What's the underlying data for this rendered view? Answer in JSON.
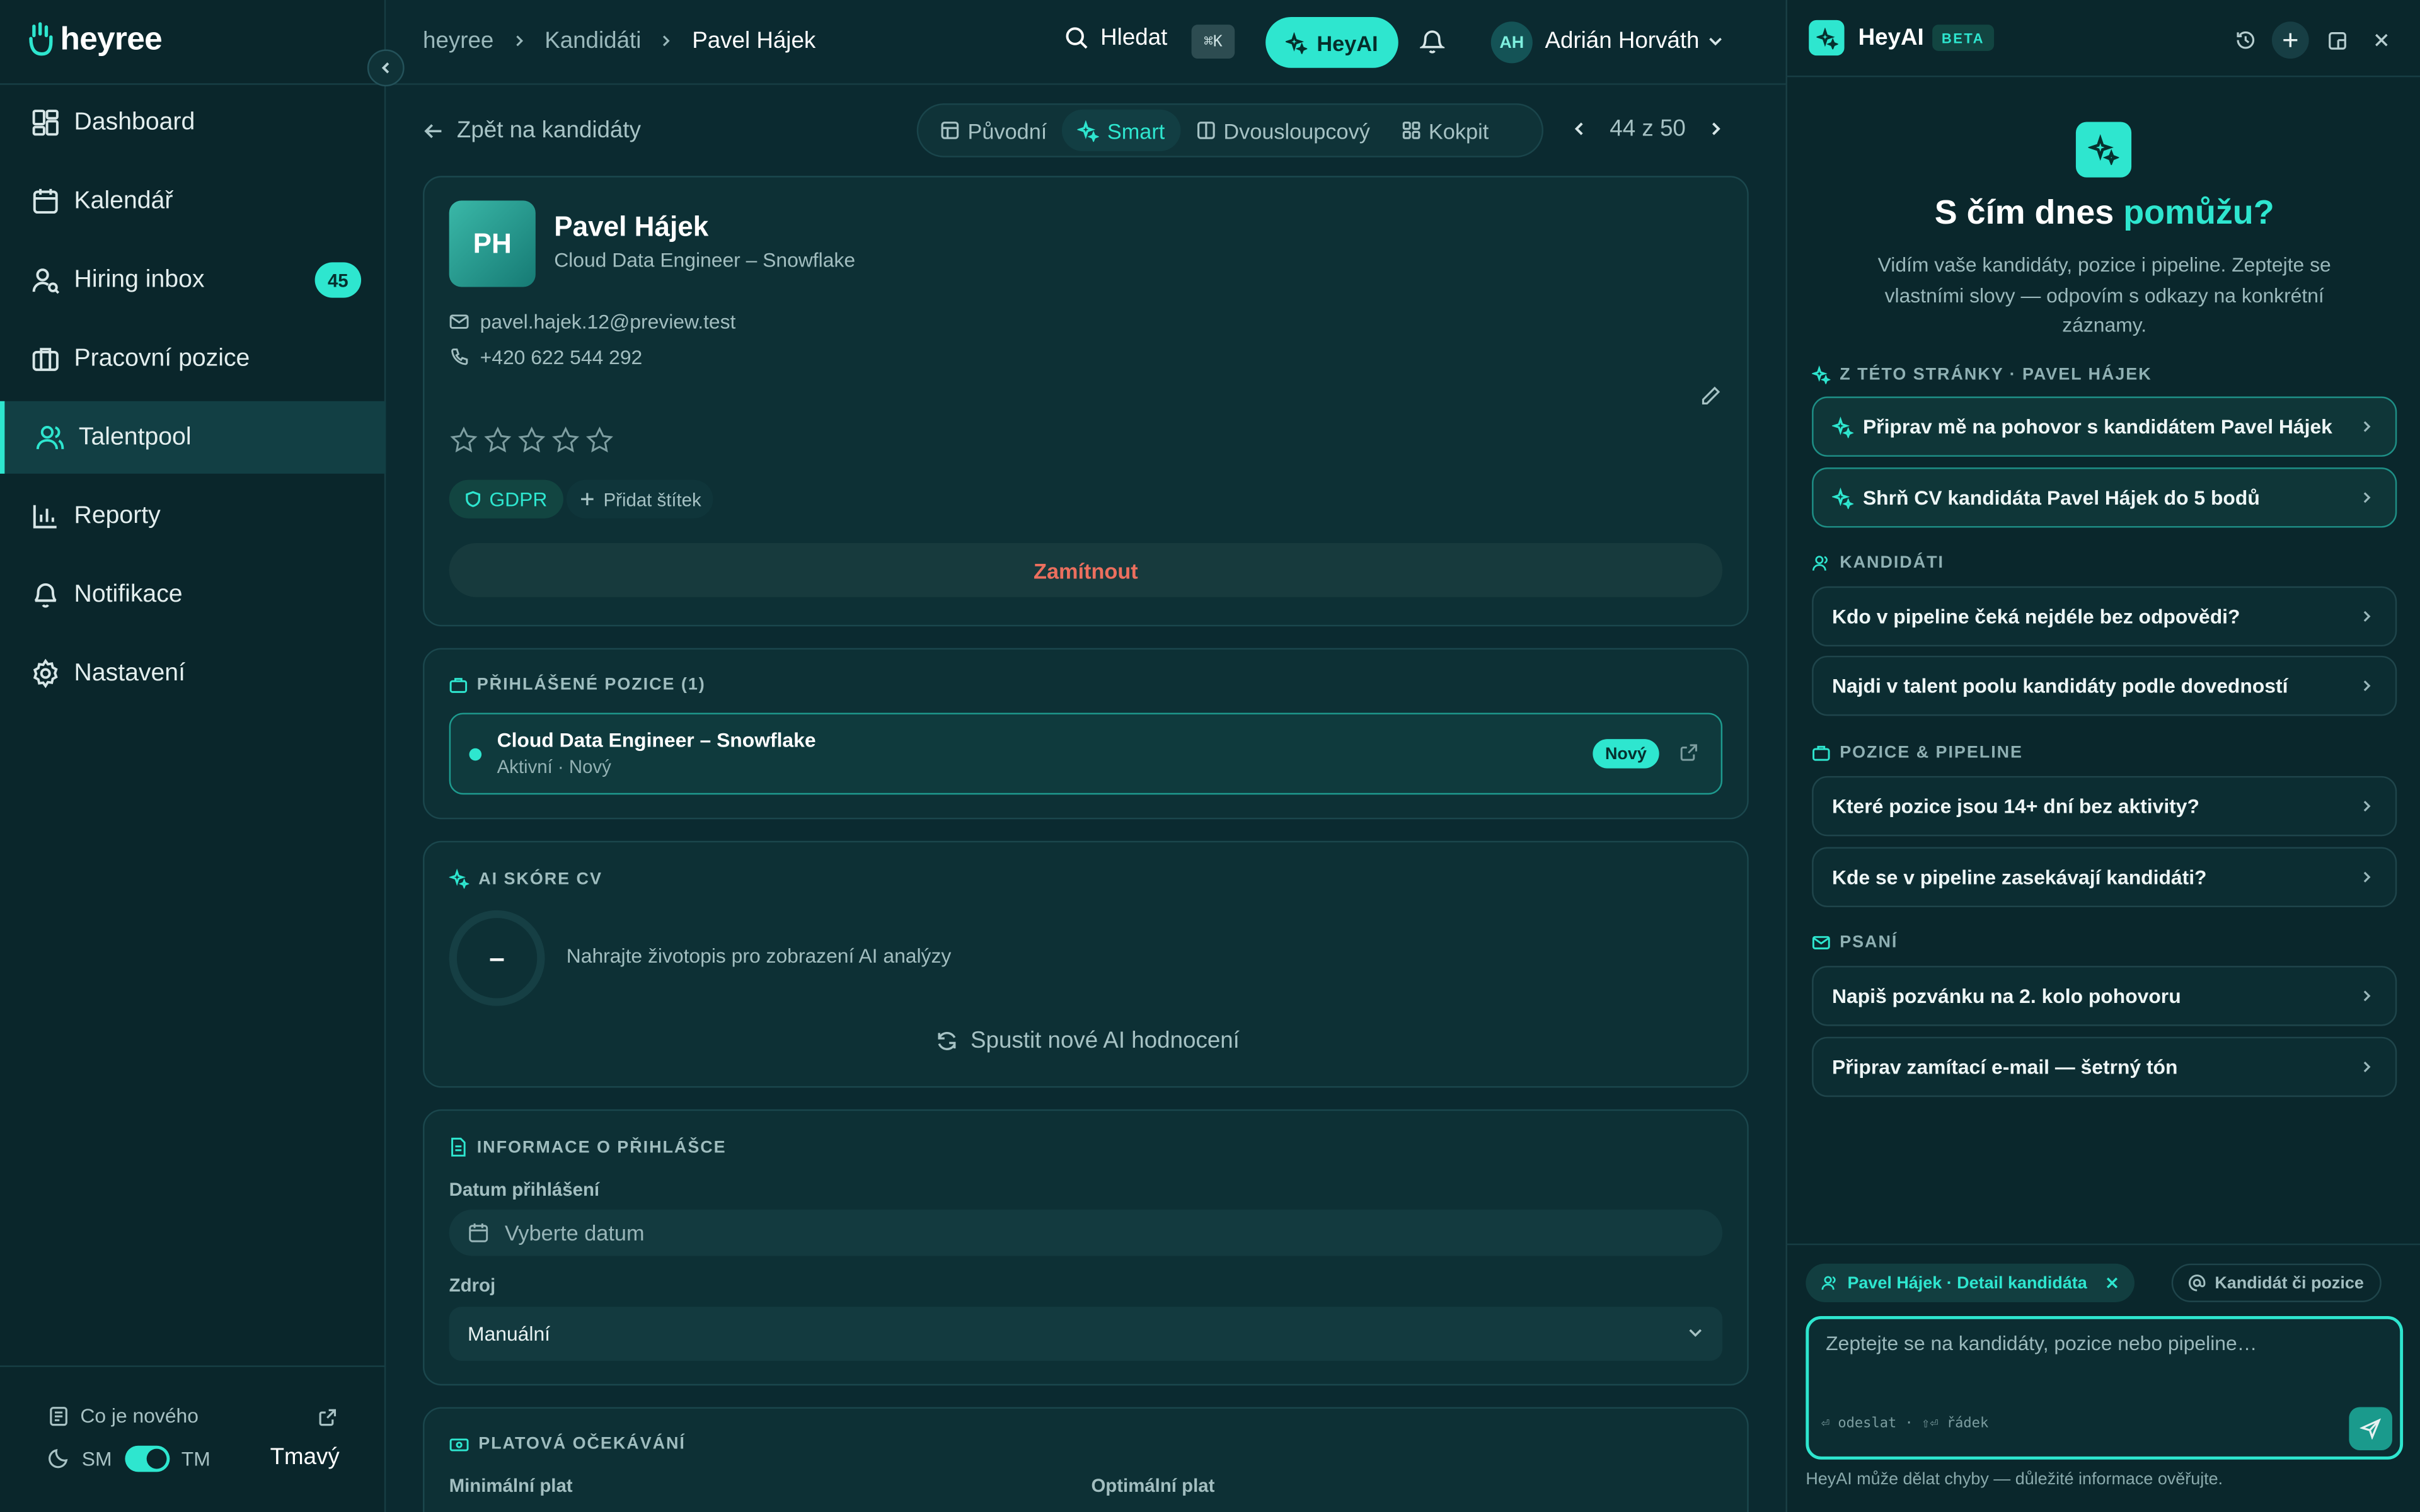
{
  "brand": {
    "name": "heyree"
  },
  "sidebar": {
    "items": [
      {
        "label": "Dashboard",
        "icon": "dashboard-icon"
      },
      {
        "label": "Kalendář",
        "icon": "calendar-icon"
      },
      {
        "label": "Hiring inbox",
        "icon": "inbox-user-icon",
        "badge": "45"
      },
      {
        "label": "Pracovní pozice",
        "icon": "briefcase-icon"
      },
      {
        "label": "Talentpool",
        "icon": "users-icon",
        "active": true
      },
      {
        "label": "Reporty",
        "icon": "bar-chart-icon"
      },
      {
        "label": "Notifikace",
        "icon": "bell-icon"
      },
      {
        "label": "Nastavení",
        "icon": "gear-icon"
      }
    ],
    "whats_new": "Co je nového",
    "theme": {
      "left": "SM",
      "right": "TM",
      "name": "Tmavý"
    }
  },
  "topbar": {
    "breadcrumb": [
      "heyree",
      "Kandidáti",
      "Pavel Hájek"
    ],
    "search_label": "Hledat",
    "shortcut": "⌘K",
    "heyai_label": "HeyAI",
    "user": {
      "initials": "AH",
      "name": "Adrián Horváth"
    }
  },
  "main": {
    "back_label": "Zpět na kandidáty",
    "views": [
      "Původní",
      "Smart",
      "Dvousloupcový",
      "Kokpit"
    ],
    "active_view": "Smart",
    "pager": "44 z 50",
    "candidate": {
      "initials": "PH",
      "name": "Pavel Hájek",
      "role": "Cloud Data Engineer – Snowflake",
      "email": "pavel.hajek.12@preview.test",
      "phone": "+420 622 544 292",
      "rating": 0,
      "rating_max": 5,
      "tags": [
        "GDPR"
      ],
      "add_tag_label": "Přidat štítek",
      "reject_label": "Zamítnout"
    },
    "positions": {
      "title": "PŘIHLÁŠENÉ POZICE (1)",
      "items": [
        {
          "title": "Cloud Data Engineer – Snowflake",
          "sub": "Aktivní · Nový",
          "badge": "Nový"
        }
      ]
    },
    "ai_score": {
      "title": "AI SKÓRE CV",
      "value": "–",
      "text": "Nahrajte životopis pro zobrazení AI analýzy",
      "rerun_label": "Spustit nové AI hodnocení"
    },
    "application": {
      "title": "INFORMACE O PŘIHLÁŠCE",
      "date_label": "Datum přihlášení",
      "date_placeholder": "Vyberte datum",
      "source_label": "Zdroj",
      "source_value": "Manuální"
    },
    "salary": {
      "title": "PLATOVÁ OČEKÁVÁNÍ",
      "min_label": "Minimální plat",
      "opt_label": "Optimální plat"
    }
  },
  "ai_panel": {
    "title": "HeyAI",
    "beta": "BETA",
    "hero_title_a": "S čím dnes ",
    "hero_title_b": "pomůžu?",
    "hero_sub": "Vidím vaše kandidáty, pozice i pipeline. Zeptejte se vlastními slovy — odpovím s odkazy na konkrétní záznamy.",
    "groups": [
      {
        "title": "Z TÉTO STRÁNKY · PAVEL HÁJEK",
        "icon": "sparkle-icon",
        "items": [
          "Připrav mě na pohovor s kandidátem Pavel Hájek",
          "Shrň CV kandidáta Pavel Hájek do 5 bodů"
        ]
      },
      {
        "title": "KANDIDÁTI",
        "icon": "users-icon",
        "items": [
          "Kdo v pipeline čeká nejdéle bez odpovědi?",
          "Najdi v talent poolu kandidáty podle dovedností"
        ]
      },
      {
        "title": "POZICE & PIPELINE",
        "icon": "briefcase-icon",
        "items": [
          "Které pozice jsou 14+ dní bez aktivity?",
          "Kde se v pipeline zasekávají kandidáti?"
        ]
      },
      {
        "title": "PSANÍ",
        "icon": "mail-icon",
        "items": [
          "Napiš pozvánku na 2. kolo pohovoru",
          "Připrav zamítací e-mail — šetrný tón"
        ]
      }
    ],
    "context_chip": "Pavel Hájek · Detail kandidáta",
    "mention_chip": "Kandidát či pozice",
    "prompt_placeholder": "Zeptejte se na kandidáty, pozice nebo pipeline…",
    "prompt_hint": "⏎ odeslat · ⇧⏎ řádek",
    "disclaimer": "HeyAI může dělat chyby — důležité informace ověřujte."
  },
  "colors": {
    "accent": "#2ee6cf",
    "background": "#0b2a30",
    "danger": "#ec6f5e"
  }
}
